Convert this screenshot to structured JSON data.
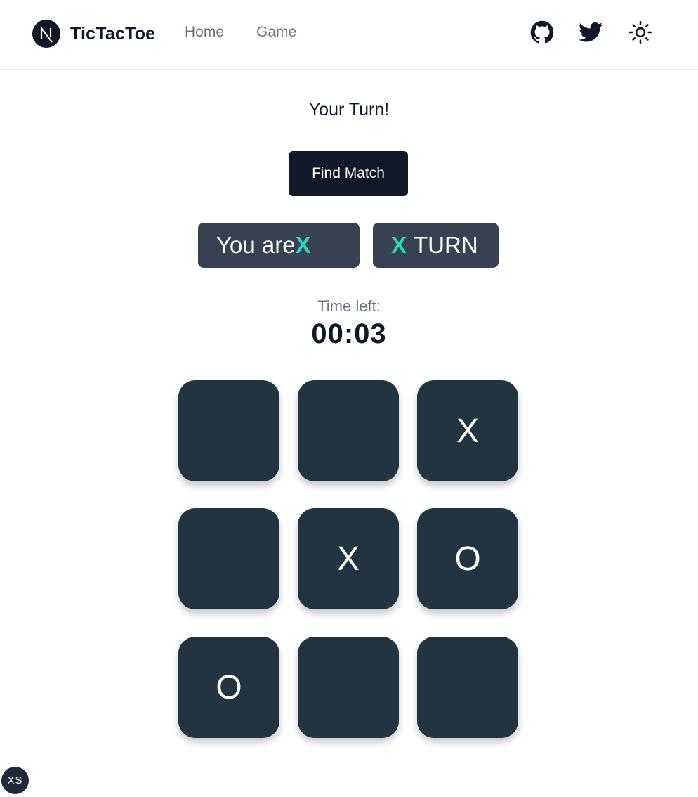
{
  "navbar": {
    "brand_name": "TicTacToe",
    "logo_icon": "nextjs-logo-icon",
    "links": [
      {
        "label": "Home"
      },
      {
        "label": "Game"
      }
    ],
    "icons": [
      "github-icon",
      "twitter-icon",
      "sun-icon"
    ]
  },
  "game": {
    "status": "Your Turn!",
    "find_match_label": "Find Match",
    "you_are_label": "You are",
    "you_are_symbol": "X",
    "turn_symbol": "X",
    "turn_label": "TURN",
    "time_left_label": "Time left:",
    "time_left_value": "00:03",
    "board": [
      "",
      "",
      "X",
      "",
      "X",
      "O",
      "O",
      "",
      ""
    ]
  },
  "breakpoint_badge": "XS",
  "colors": {
    "accent": "#2dd4bf",
    "cell_bg": "#213440",
    "button_bg": "#111827",
    "chip_bg": "#374151"
  }
}
